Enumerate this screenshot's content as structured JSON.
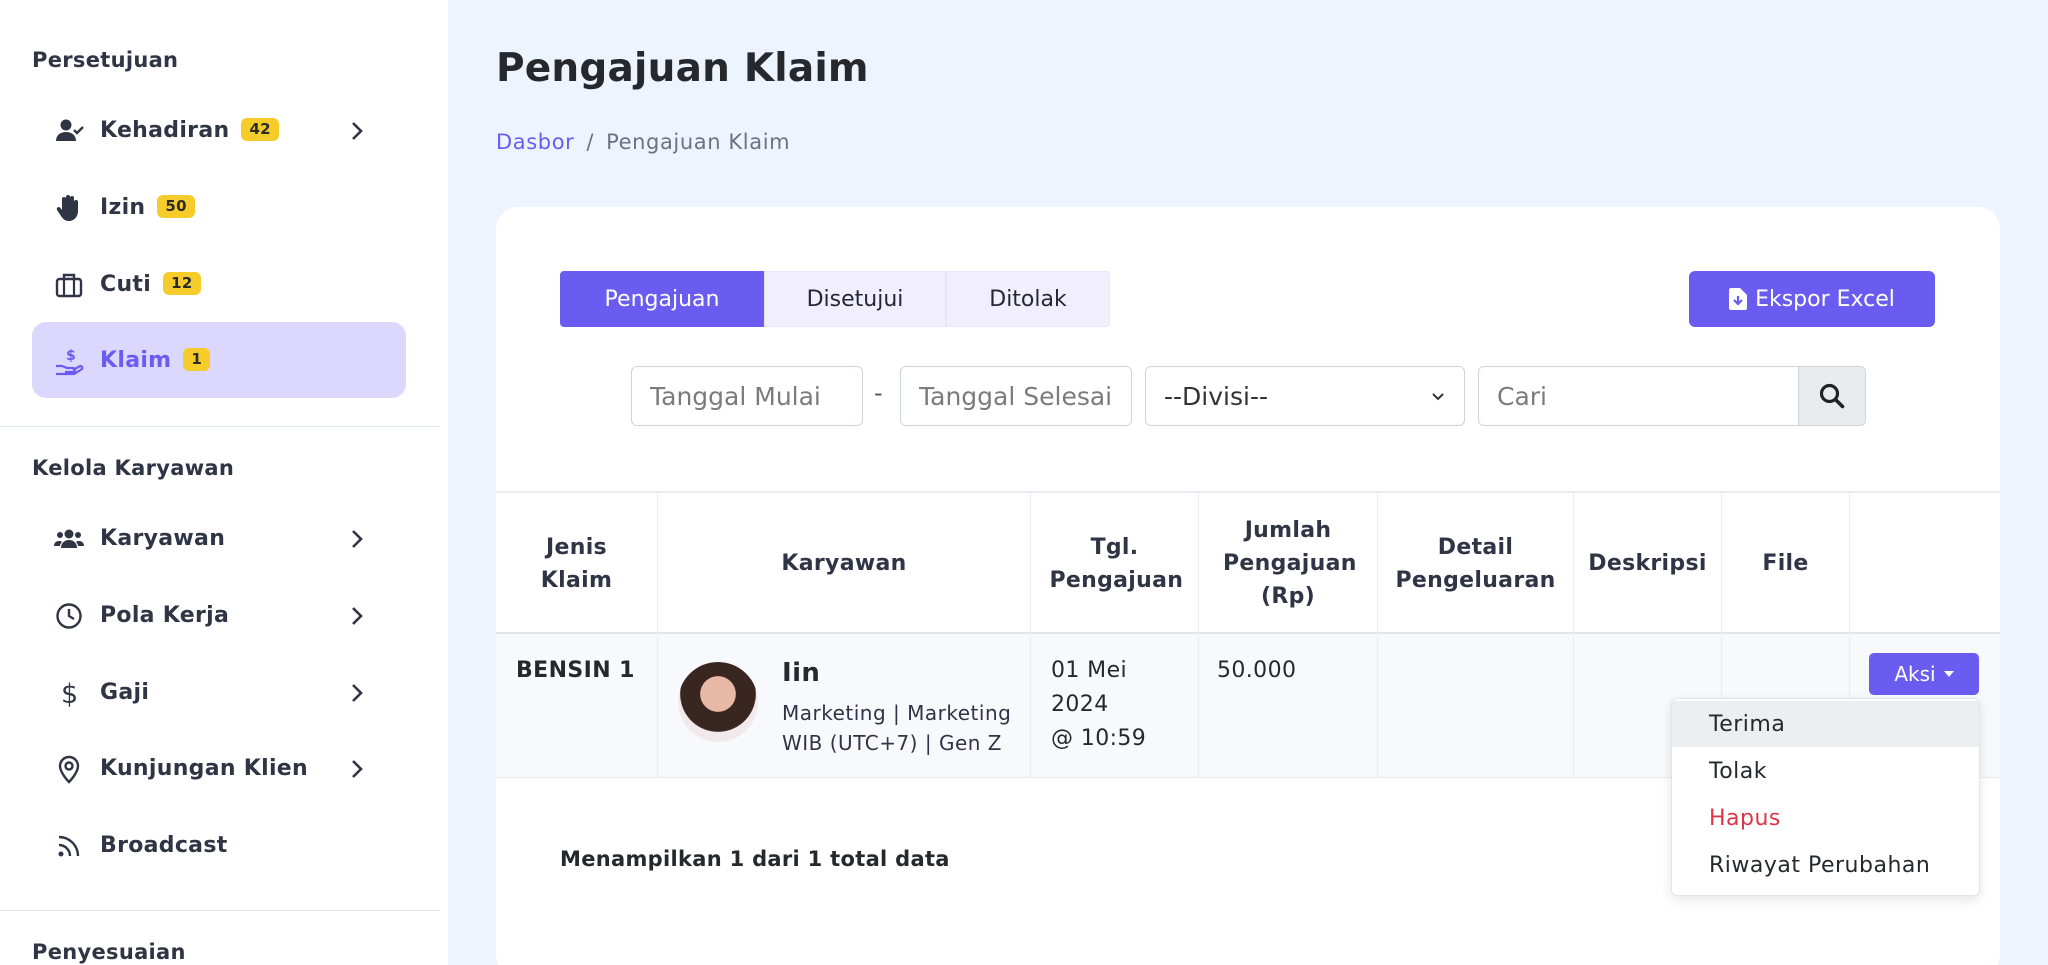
{
  "sidebar": {
    "section_approval": "Persetujuan",
    "section_manage": "Kelola Karyawan",
    "section_adjust": "Penyesuaian",
    "items": [
      {
        "label": "Kehadiran",
        "badge": "42",
        "icon": "user-check-icon"
      },
      {
        "label": "Izin",
        "badge": "50",
        "icon": "hand-icon"
      },
      {
        "label": "Cuti",
        "badge": "12",
        "icon": "briefcase-icon"
      },
      {
        "label": "Klaim",
        "badge": "1",
        "icon": "hand-coin-icon"
      },
      {
        "label": "Karyawan",
        "icon": "users-icon"
      },
      {
        "label": "Pola Kerja",
        "icon": "clock-icon"
      },
      {
        "label": "Gaji",
        "icon": "dollar-icon"
      },
      {
        "label": "Kunjungan Klien",
        "icon": "map-pin-icon"
      },
      {
        "label": "Broadcast",
        "icon": "rss-icon"
      }
    ]
  },
  "page": {
    "title": "Pengajuan Klaim",
    "breadcrumb": {
      "home": "Dasbor",
      "separator": "/",
      "current": "Pengajuan Klaim"
    }
  },
  "tabs": [
    "Pengajuan",
    "Disetujui",
    "Ditolak"
  ],
  "export_label": "Ekspor Excel",
  "filters": {
    "start_placeholder": "Tanggal Mulai",
    "dash": "-",
    "end_placeholder": "Tanggal Selesai",
    "division": "--Divisi--",
    "search_placeholder": "Cari"
  },
  "table": {
    "headers": [
      "Jenis Klaim",
      "Karyawan",
      "Tgl. Pengajuan",
      "Jumlah Pengajuan (Rp)",
      "Detail Pengeluaran",
      "Deskripsi",
      "File"
    ],
    "rows": [
      {
        "type": "BENSIN 1",
        "employee_name": "Iin",
        "employee_line1": "Marketing | Marketing",
        "employee_line2": "WIB (UTC+7) | Gen Z",
        "date_line1": "01 Mei",
        "date_line2": "2024",
        "date_line3": "@ 10:59",
        "amount": "50.000",
        "action_label": "Aksi"
      }
    ]
  },
  "summary": "Menampilkan 1 dari 1 total data",
  "action_menu": [
    "Terima",
    "Tolak",
    "Hapus",
    "Riwayat Perubahan"
  ],
  "colors": {
    "accent": "#6a5cf0",
    "badge": "#f6cc2a",
    "danger": "#dc3545",
    "background": "#eef4fd"
  }
}
